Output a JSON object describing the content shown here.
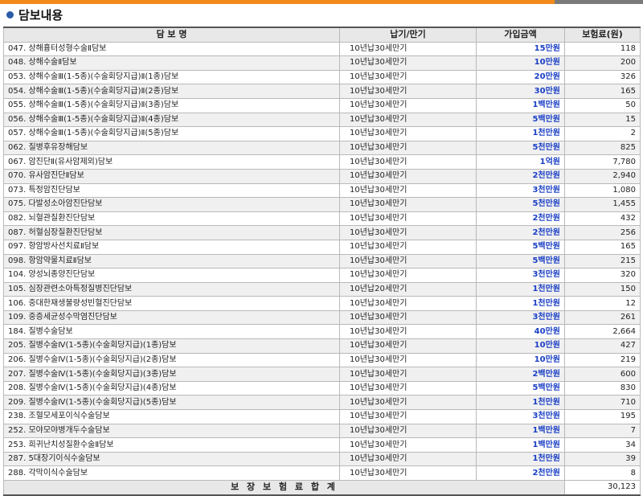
{
  "section": {
    "title": "담보내용"
  },
  "table": {
    "headers": [
      "담 보 명",
      "납기/만기",
      "가입금액",
      "보험료(원)"
    ],
    "rows": [
      [
        "047. 상해흉터성형수술Ⅱ담보",
        "10년납30세만기",
        "15만원",
        "118"
      ],
      [
        "048. 상해수술Ⅱ담보",
        "10년납30세만기",
        "10만원",
        "200"
      ],
      [
        "053. 상해수술Ⅲ(1-5종)(수술회당지급)Ⅱ(1종)담보",
        "10년납30세만기",
        "20만원",
        "326"
      ],
      [
        "054. 상해수술Ⅲ(1-5종)(수술회당지급)Ⅱ(2종)담보",
        "10년납30세만기",
        "30만원",
        "165"
      ],
      [
        "055. 상해수술Ⅲ(1-5종)(수술회당지급)Ⅱ(3종)담보",
        "10년납30세만기",
        "1백만원",
        "50"
      ],
      [
        "056. 상해수술Ⅲ(1-5종)(수술회당지급)Ⅱ(4종)담보",
        "10년납30세만기",
        "5백만원",
        "15"
      ],
      [
        "057. 상해수술Ⅲ(1-5종)(수술회당지급)Ⅱ(5종)담보",
        "10년납30세만기",
        "1천만원",
        "2"
      ],
      [
        "062. 질병후유장해담보",
        "10년납30세만기",
        "5천만원",
        "825"
      ],
      [
        "067. 암진단Ⅱ(유사암제외)담보",
        "10년납30세만기",
        "1억원",
        "7,780"
      ],
      [
        "070. 유사암진단Ⅱ담보",
        "10년납30세만기",
        "2천만원",
        "2,940"
      ],
      [
        "073. 특정암진단담보",
        "10년납30세만기",
        "3천만원",
        "1,080"
      ],
      [
        "075. 다발성소아암진단담보",
        "10년납30세만기",
        "5천만원",
        "1,455"
      ],
      [
        "082. 뇌혈관질환진단담보",
        "10년납30세만기",
        "2천만원",
        "432"
      ],
      [
        "087. 허혈심장질환진단담보",
        "10년납30세만기",
        "2천만원",
        "256"
      ],
      [
        "097. 항암방사선치료Ⅱ담보",
        "10년납30세만기",
        "5백만원",
        "165"
      ],
      [
        "098. 항암약물치료Ⅱ담보",
        "10년납30세만기",
        "5백만원",
        "215"
      ],
      [
        "104. 양성뇌종양진단담보",
        "10년납30세만기",
        "3천만원",
        "320"
      ],
      [
        "105. 심장관련소아특정질병진단담보",
        "10년납20세만기",
        "1천만원",
        "150"
      ],
      [
        "106. 중대한재생불량성빈혈진단담보",
        "10년납30세만기",
        "1천만원",
        "12"
      ],
      [
        "109. 중증세균성수막염진단담보",
        "10년납30세만기",
        "3천만원",
        "261"
      ],
      [
        "184. 질병수술담보",
        "10년납30세만기",
        "40만원",
        "2,664"
      ],
      [
        "205. 질병수술Ⅳ(1-5종)(수술회당지급)(1종)담보",
        "10년납30세만기",
        "10만원",
        "427"
      ],
      [
        "206. 질병수술Ⅳ(1-5종)(수술회당지급)(2종)담보",
        "10년납30세만기",
        "10만원",
        "219"
      ],
      [
        "207. 질병수술Ⅳ(1-5종)(수술회당지급)(3종)담보",
        "10년납30세만기",
        "2백만원",
        "600"
      ],
      [
        "208. 질병수술Ⅳ(1-5종)(수술회당지급)(4종)담보",
        "10년납30세만기",
        "5백만원",
        "830"
      ],
      [
        "209. 질병수술Ⅳ(1-5종)(수술회당지급)(5종)담보",
        "10년납30세만기",
        "1천만원",
        "710"
      ],
      [
        "238. 조혈모세포이식수술담보",
        "10년납30세만기",
        "3천만원",
        "195"
      ],
      [
        "252. 모야모야병개두수술담보",
        "10년납30세만기",
        "1백만원",
        "7"
      ],
      [
        "253. 희귀난치성질환수술Ⅱ담보",
        "10년납30세만기",
        "1백만원",
        "34"
      ],
      [
        "287. 5대장기이식수술담보",
        "10년납30세만기",
        "1천만원",
        "39"
      ],
      [
        "288. 각막이식수술담보",
        "10년납30세만기",
        "2천만원",
        "8"
      ]
    ],
    "total_label": "보 장 보 험 료 합 계",
    "total_value": "30,123"
  },
  "colors": {
    "top_bar": "#f28a1a",
    "top_bar_right": "#7a7a7a",
    "bullet": "#2a5ca8",
    "amount_text": "#1a3fc4",
    "header_bg": "#e8e8e8",
    "alt_row_bg": "#f0f0f0"
  }
}
